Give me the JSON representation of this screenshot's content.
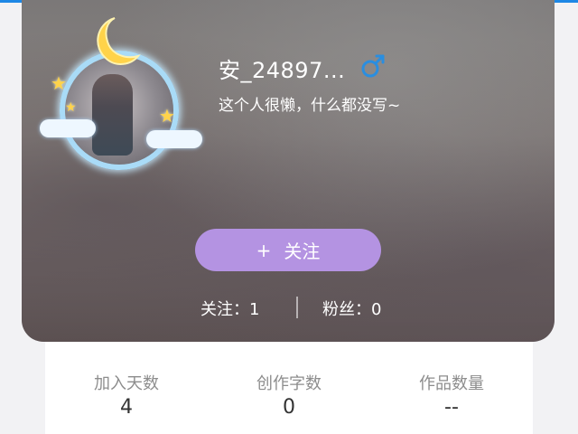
{
  "profile": {
    "username": "安_24897...",
    "gender_icon": "male-icon",
    "bio": "这个人很懒，什么都没写~"
  },
  "follow_button": {
    "icon": "+",
    "label": "关注"
  },
  "counts": {
    "following_label": "关注：",
    "following_value": "1",
    "fans_label": "粉丝：",
    "fans_value": "0"
  },
  "metrics": [
    {
      "label": "加入天数",
      "value": "4"
    },
    {
      "label": "创作字数",
      "value": "0"
    },
    {
      "label": "作品数量",
      "value": "--"
    }
  ],
  "colors": {
    "accent": "#b493e2",
    "gender_blue": "#2a8ee0",
    "top_line": "#1e88e5"
  }
}
